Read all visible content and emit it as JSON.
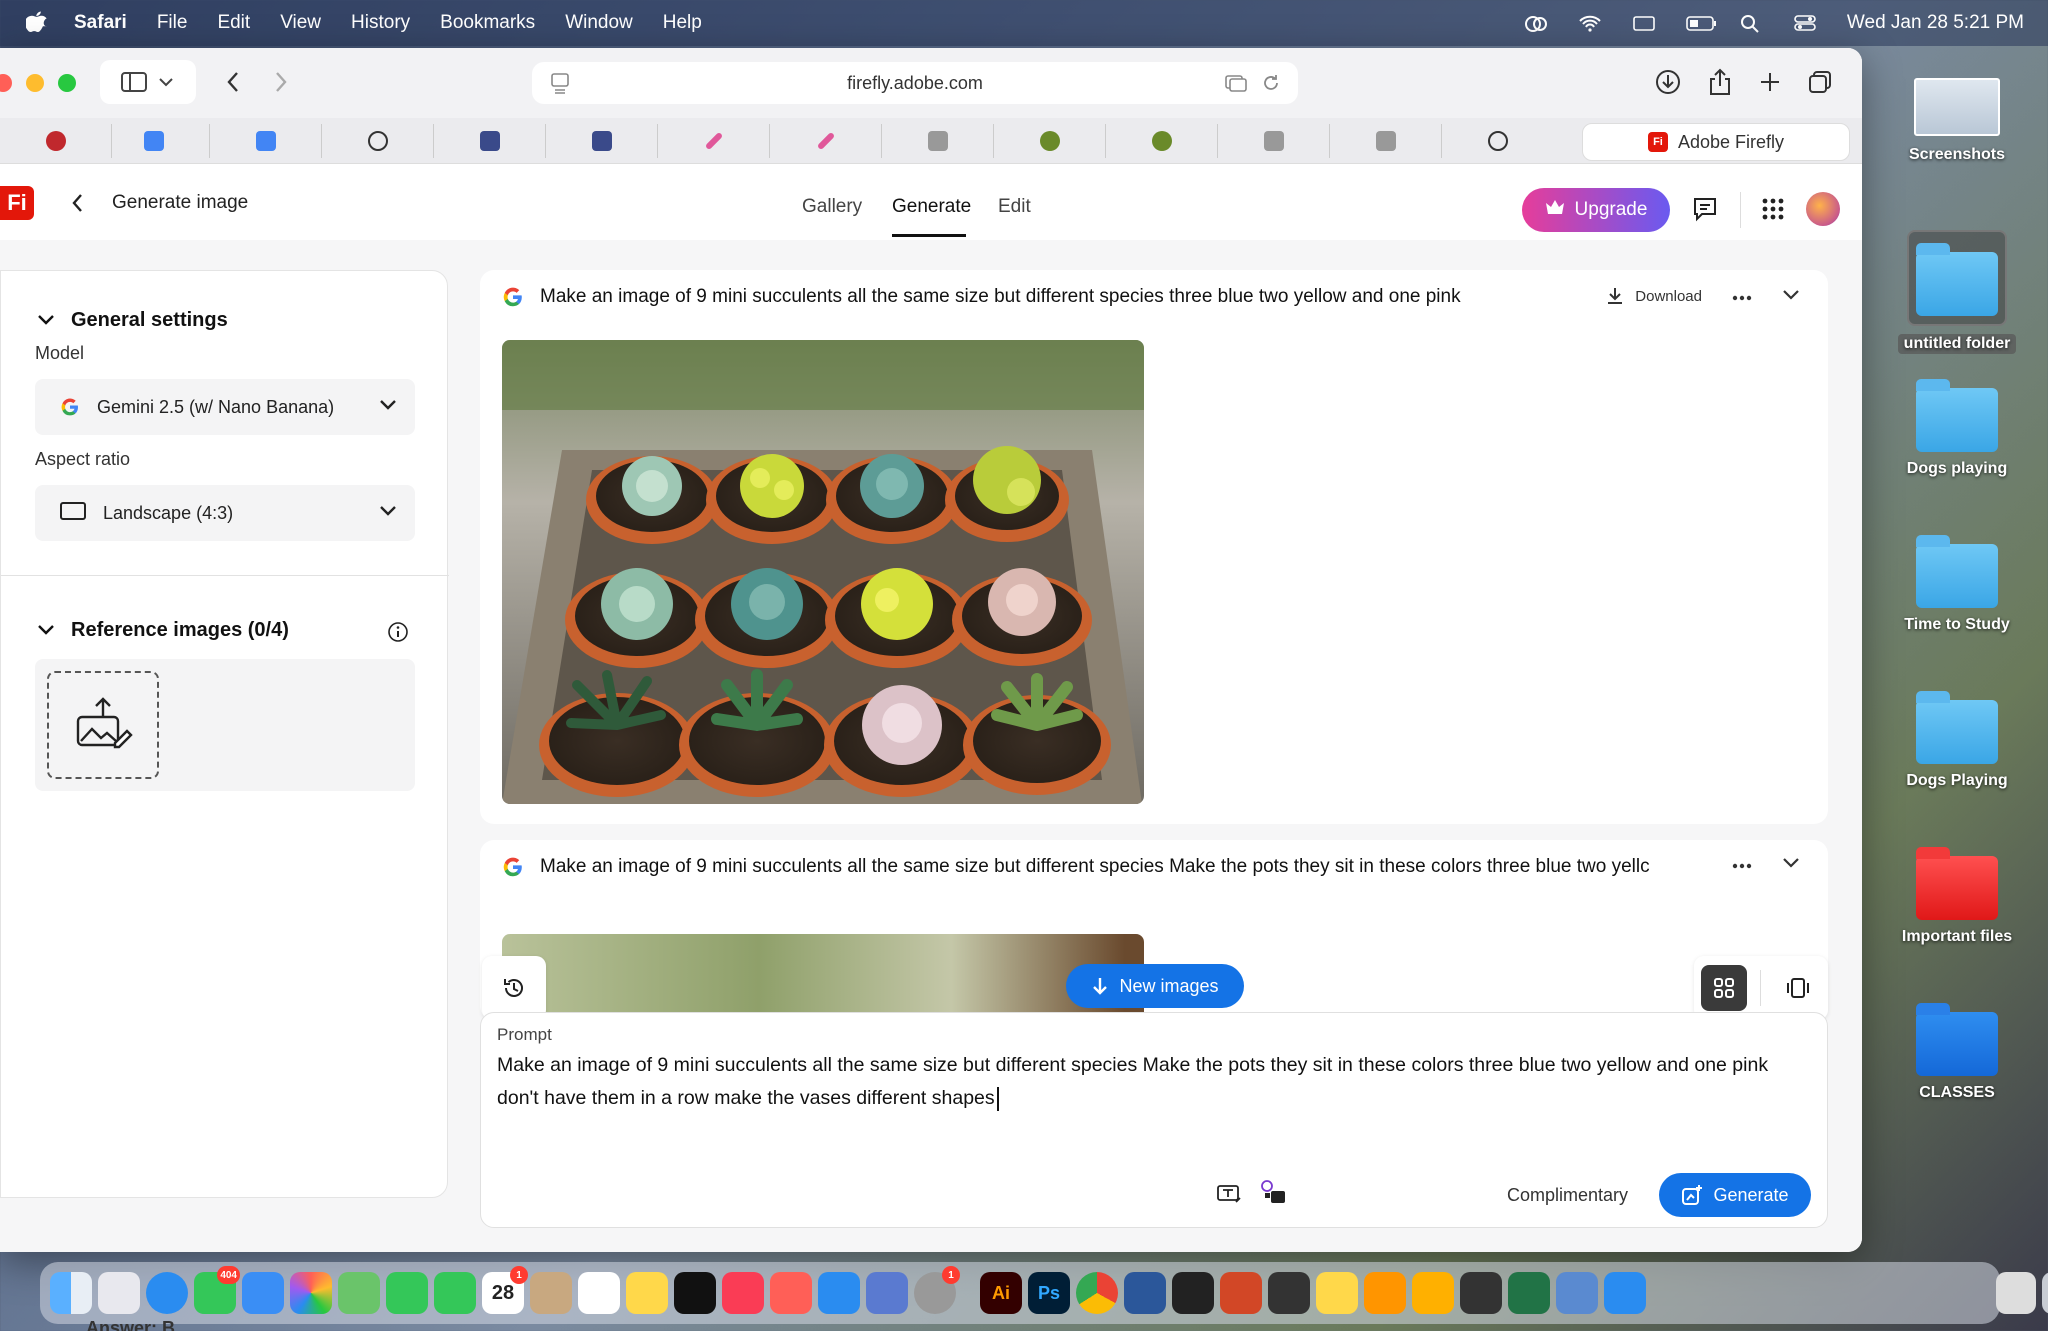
{
  "menubar": {
    "app_name": "Safari",
    "items": [
      "File",
      "Edit",
      "View",
      "History",
      "Bookmarks",
      "Window",
      "Help"
    ],
    "clock": "Wed Jan 28  5:21 PM"
  },
  "desktop": {
    "items": [
      {
        "label": "Screenshots",
        "kind": "thumbnail"
      },
      {
        "label": "untitled folder",
        "kind": "folder"
      },
      {
        "label": "Dogs playing",
        "kind": "folder"
      },
      {
        "label": "Time to Study",
        "kind": "folder"
      },
      {
        "label": "Dogs Playing",
        "kind": "folder"
      },
      {
        "label": "Important files",
        "kind": "folder-red"
      },
      {
        "label": "CLASSES",
        "kind": "folder-blue"
      }
    ]
  },
  "browser": {
    "url": "firefly.adobe.com",
    "active_tab_title": "Adobe Firefly",
    "tab_icons": [
      "opera-icon",
      "docs-icon",
      "docs-icon",
      "chatgpt-icon",
      "arrow-icon",
      "arrow-icon",
      "quill-icon",
      "quill-icon",
      "w-icon",
      "globe-icon",
      "globe-icon",
      "e-icon",
      "g-icon",
      "chatgpt-icon"
    ]
  },
  "app": {
    "logo_text": "Fi",
    "page_title": "Generate image",
    "nav_tabs": [
      "Gallery",
      "Generate",
      "Edit"
    ],
    "active_tab": "Generate",
    "upgrade_label": "Upgrade"
  },
  "settings": {
    "general_title": "General settings",
    "model_label": "Model",
    "model_value": "Gemini 2.5 (w/ Nano Banana)",
    "aspect_label": "Aspect ratio",
    "aspect_value": "Landscape (4:3)",
    "reference_title": "Reference images (0/4)"
  },
  "generations": [
    {
      "prompt": "Make an image of 9 mini succulents all the same size but different species three blue two yellow and one pink",
      "download_label": "Download"
    },
    {
      "prompt": "Make an image of 9 mini succulents all the same size but different species Make the pots they sit in these colors three blue two yellc"
    }
  ],
  "controls": {
    "new_images_label": "New images"
  },
  "prompt_box": {
    "label": "Prompt",
    "text": "Make an image of 9 mini succulents all the same size but different species Make the pots they sit in these colors  three blue two yellow and one pink don't have them in a row make the vases different shapes",
    "complimentary_label": "Complimentary",
    "generate_label": "Generate"
  },
  "dock": {
    "calendar_day": "28",
    "messages_badge": "404",
    "calendar_badge": "1",
    "settings_badge": "1",
    "bottom_text": "Answer: B"
  },
  "colors": {
    "accent_blue": "#1473e6",
    "firefly_red": "#e3170a"
  }
}
